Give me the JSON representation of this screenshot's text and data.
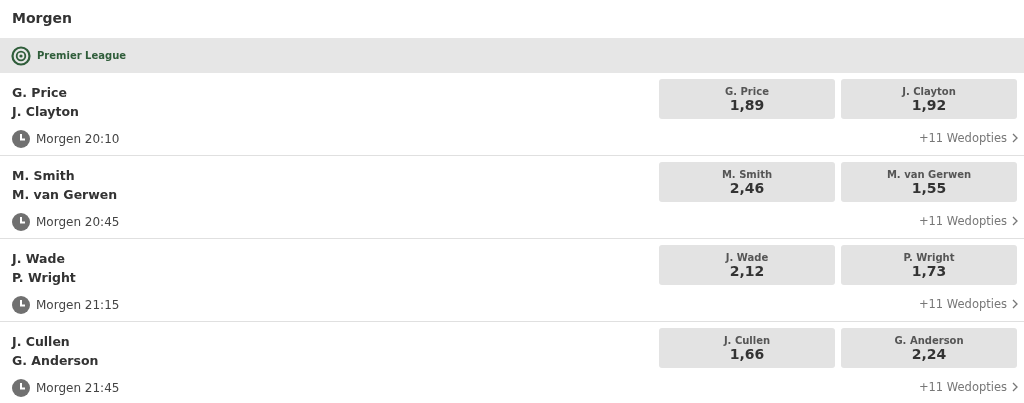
{
  "heading": "Morgen",
  "league": {
    "name": "Premier League"
  },
  "matches": [
    {
      "players": [
        "G. Price",
        "J. Clayton"
      ],
      "time": "Morgen 20:10",
      "odds": [
        {
          "player": "G. Price",
          "price": "1,89"
        },
        {
          "player": "J. Clayton",
          "price": "1,92"
        }
      ],
      "more": "+11 Wedopties"
    },
    {
      "players": [
        "M. Smith",
        "M. van Gerwen"
      ],
      "time": "Morgen 20:45",
      "odds": [
        {
          "player": "M. Smith",
          "price": "2,46"
        },
        {
          "player": "M. van Gerwen",
          "price": "1,55"
        }
      ],
      "more": "+11 Wedopties"
    },
    {
      "players": [
        "J. Wade",
        "P. Wright"
      ],
      "time": "Morgen 21:15",
      "odds": [
        {
          "player": "J. Wade",
          "price": "2,12"
        },
        {
          "player": "P. Wright",
          "price": "1,73"
        }
      ],
      "more": "+11 Wedopties"
    },
    {
      "players": [
        "J. Cullen",
        "G. Anderson"
      ],
      "time": "Morgen 21:45",
      "odds": [
        {
          "player": "J. Cullen",
          "price": "1,66"
        },
        {
          "player": "G. Anderson",
          "price": "2,24"
        }
      ],
      "more": "+11 Wedopties"
    }
  ]
}
